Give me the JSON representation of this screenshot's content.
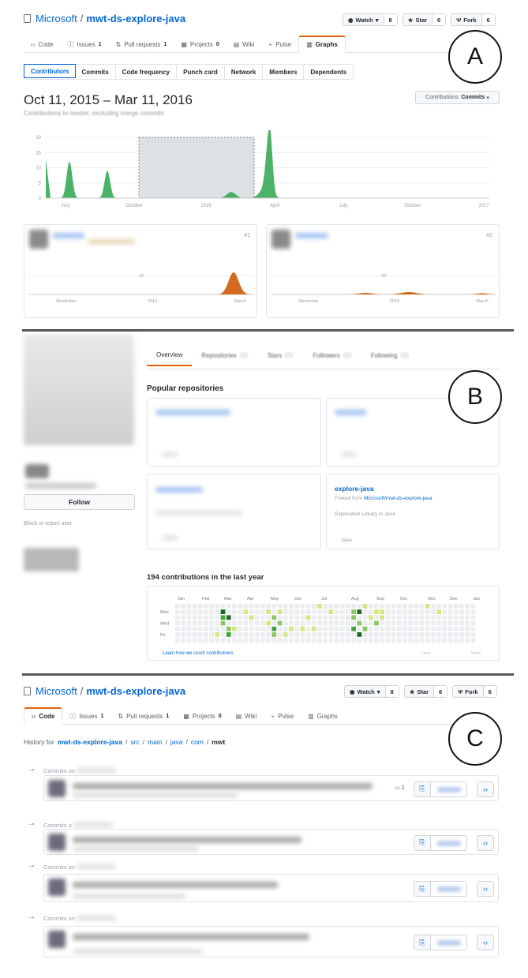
{
  "panel_labels": [
    "A",
    "B",
    "C"
  ],
  "repo": {
    "owner": "Microsoft",
    "separator": "/",
    "name": "mwt-ds-explore-java"
  },
  "actions": {
    "watch": "Watch",
    "watch_count": "8",
    "star": "Star",
    "star_count": "6",
    "fork": "Fork",
    "fork_count": "6"
  },
  "panelA": {
    "tabs": [
      {
        "label": "Code",
        "icon": "code-icon",
        "count": ""
      },
      {
        "label": "Issues",
        "icon": "issue-icon",
        "count": "1"
      },
      {
        "label": "Pull requests",
        "icon": "pr-icon",
        "count": "1"
      },
      {
        "label": "Projects",
        "icon": "project-icon",
        "count": "0"
      },
      {
        "label": "Wiki",
        "icon": "wiki-icon",
        "count": ""
      },
      {
        "label": "Pulse",
        "icon": "pulse-icon",
        "count": ""
      },
      {
        "label": "Graphs",
        "icon": "graph-icon",
        "count": ""
      }
    ],
    "selected_tab": "Graphs",
    "subnav": [
      "Contributors",
      "Commits",
      "Code frequency",
      "Punch card",
      "Network",
      "Members",
      "Dependents"
    ],
    "selected_subnav": "Contributors",
    "date_range": "Oct 11, 2015 – Mar 11, 2016",
    "subtitle": "Contributions to master, excluding merge commits",
    "contrib_dropdown_prefix": "Contributions:",
    "contrib_dropdown_value": "Commits",
    "main_chart": {
      "yticks": [
        "20",
        "15",
        "10",
        "5",
        "0"
      ],
      "xticks": [
        "July",
        "October",
        "2016",
        "April",
        "July",
        "October",
        "2017"
      ]
    },
    "contributors": [
      {
        "rank": "#1",
        "yticks": [
          "10"
        ],
        "xticks": [
          "November",
          "2016",
          "March"
        ]
      },
      {
        "rank": "#2",
        "yticks": [
          "10"
        ],
        "xticks": [
          "November",
          "2016",
          "March"
        ]
      }
    ],
    "colors": {
      "area": "#2ca44e",
      "contrib": "#d26b1e",
      "brand": "#0366d6",
      "accent": "#e36209"
    }
  },
  "panelB": {
    "tabs": [
      "Overview",
      "Repositories",
      "Stars",
      "Followers",
      "Following"
    ],
    "selected_tab": "Overview",
    "follow_button": "Follow",
    "block_link": "Block or report user",
    "popular_title": "Popular repositories",
    "explore_card": {
      "name": "explore-java",
      "forked_prefix": "Forked from",
      "forked_from": "Microsoft/mwt-ds-explore-java",
      "description": "Exploration Library in Java",
      "language": "Java"
    },
    "contrib_title": "194 contributions in the last year",
    "months": [
      "Jan",
      "Feb",
      "Mar",
      "Apr",
      "May",
      "Jun",
      "Jul",
      "Aug",
      "Sep",
      "Oct",
      "Nov",
      "Dec",
      "Jan"
    ],
    "days": [
      "Mon",
      "Wed",
      "Fri"
    ],
    "learn_link": "Learn how we count contributions.",
    "less": "Less",
    "more": "More"
  },
  "panelC": {
    "tabs": [
      {
        "label": "Code",
        "icon": "code-icon",
        "count": ""
      },
      {
        "label": "Issues",
        "icon": "issue-icon",
        "count": "1"
      },
      {
        "label": "Pull requests",
        "icon": "pr-icon",
        "count": "1"
      },
      {
        "label": "Projects",
        "icon": "project-icon",
        "count": "0"
      },
      {
        "label": "Wiki",
        "icon": "wiki-icon",
        "count": ""
      },
      {
        "label": "Pulse",
        "icon": "pulse-icon",
        "count": ""
      },
      {
        "label": "Graphs",
        "icon": "graph-icon",
        "count": ""
      }
    ],
    "selected_tab": "Code",
    "history_prefix": "History for",
    "path": [
      "mwt-ds-explore-java",
      "src",
      "main",
      "java",
      "com",
      "mwt"
    ],
    "commit_group_labels": [
      "Commits on",
      "Commits o",
      "Commits on",
      "Commits on"
    ],
    "comment_count": "2"
  }
}
